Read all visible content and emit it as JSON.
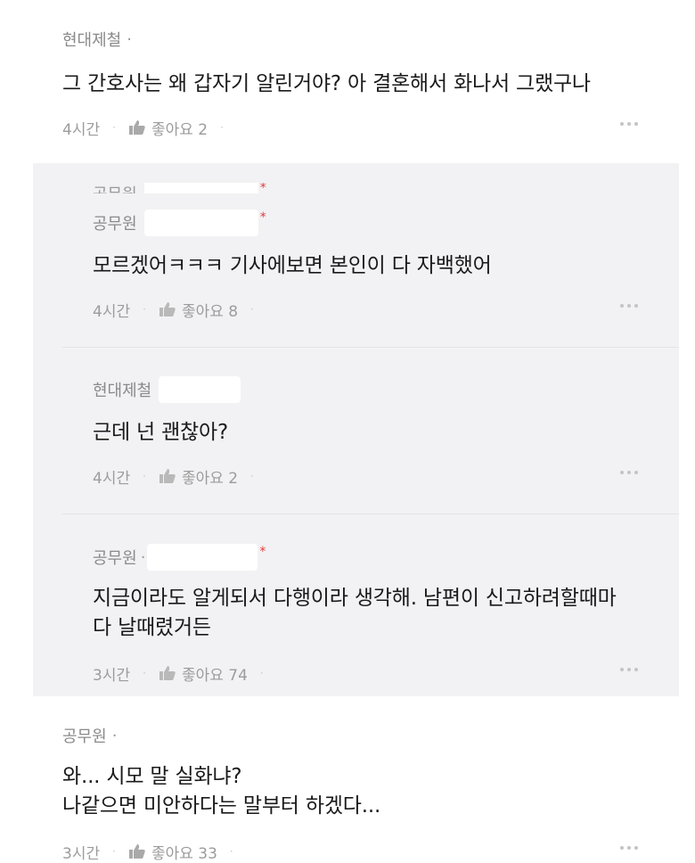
{
  "comments": [
    {
      "author": "현대제철",
      "author_suffix": "·",
      "text": "그 간호사는 왜 갑자기 알린거야? 아 결혼해서 화나서 그랬구나",
      "time": "4시간",
      "like_label": "좋아요 2"
    }
  ],
  "replies": [
    {
      "author": "공무원",
      "text": "모르겠어ㅋㅋㅋ 기사에보면 본인이 다 자백했어",
      "time": "4시간",
      "like_label": "좋아요 8"
    },
    {
      "author": "현대제철",
      "text": "근데 넌 괜찮아?",
      "time": "4시간",
      "like_label": "좋아요 2"
    },
    {
      "author": "공무원",
      "author_suffix": "·",
      "text_line1": "지금이라도 알게되서 다행이라 생각해. 남편이 신고하려할때마",
      "text_line2": "다 날때렸거든",
      "time": "3시간",
      "like_label": "좋아요 74"
    }
  ],
  "bottom_comment": {
    "author": "공무원",
    "author_suffix": "·",
    "text_line1": "와... 시모 말 실화냐?",
    "text_line2": "나같으면 미안하다는 말부터 하겠다...",
    "time": "3시간",
    "like_label": "좋아요 33"
  },
  "colors": {
    "reply_panel_bg": "#f2f2f4",
    "meta_text": "#9c9c9c",
    "author_text": "#8a8a8a",
    "mask_star": "#e23b3b"
  },
  "icons": {
    "like": "thumbs-up-icon",
    "more": "more-horizontal-icon"
  }
}
